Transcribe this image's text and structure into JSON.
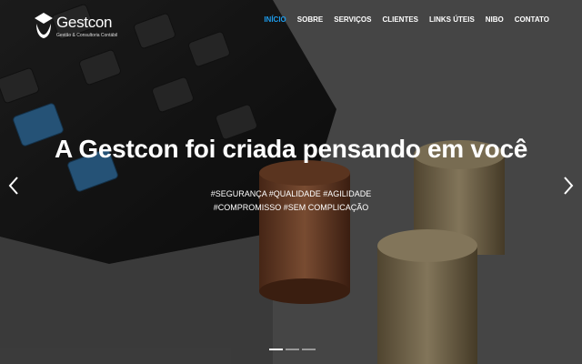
{
  "brand": {
    "name": "Gestcon",
    "subtitle": "Gestão & Consultoria Contábil"
  },
  "nav": {
    "items": [
      "INÍCIO",
      "SOBRE",
      "SERVIÇOS",
      "CLIENTES",
      "LINKS ÚTEIS",
      "NIBO",
      "CONTATO"
    ],
    "active_index": 0
  },
  "hero": {
    "headline": "A Gestcon foi criada pensando em você",
    "tagline": "#SEGURANÇA #QUALIDADE #AGILIDADE #COMPROMISSO #SEM COMPLICAÇÃO"
  },
  "carousel": {
    "slide_count": 3,
    "active_slide": 1,
    "prev_icon": "chevron-left-icon",
    "next_icon": "chevron-right-icon"
  },
  "colors": {
    "accent": "#1e9bea",
    "text": "#ffffff"
  }
}
